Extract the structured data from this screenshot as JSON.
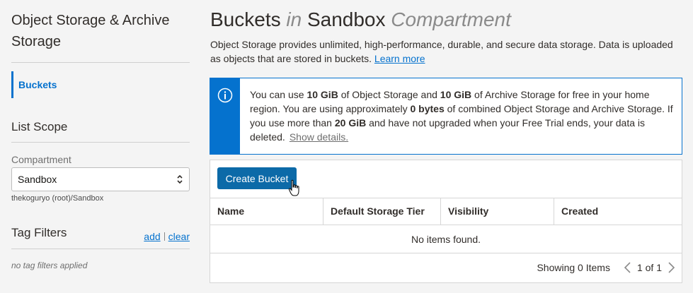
{
  "sidebar": {
    "title": "Object Storage & Archive Storage",
    "nav_active": "Buckets",
    "list_scope_title": "List Scope",
    "compartment_label": "Compartment",
    "compartment_value": "Sandbox",
    "compartment_path": "thekoguryo (root)/Sandbox",
    "tag_filters_title": "Tag Filters",
    "tag_add": "add",
    "tag_clear": "clear",
    "no_tags": "no tag filters applied"
  },
  "header": {
    "title_part1": "Buckets",
    "title_in": "in",
    "title_compartment": "Sandbox",
    "title_suffix": "Compartment",
    "description": "Object Storage provides unlimited, high-performance, durable, and secure data storage. Data is uploaded as objects that are stored in buckets.",
    "learn_more": "Learn more"
  },
  "info": {
    "t1": "You can use ",
    "b1": "10 GiB",
    "t2": " of Object Storage and ",
    "b2": "10 GiB",
    "t3": " of Archive Storage for free in your home region. You are using approximately ",
    "b3": "0 bytes",
    "t4": " of combined Object Storage and Archive Storage. If you use more than ",
    "b4": "20 GiB",
    "t5": " and have not upgraded when your Free Trial ends, your data is deleted.",
    "show_details": "Show details."
  },
  "table": {
    "create_button": "Create Bucket",
    "columns": [
      "Name",
      "Default Storage Tier",
      "Visibility",
      "Created"
    ],
    "empty_message": "No items found.",
    "showing": "Showing 0 Items",
    "page": "1 of 1"
  },
  "colors": {
    "accent": "#0572ce",
    "button": "#0c6aa8"
  }
}
